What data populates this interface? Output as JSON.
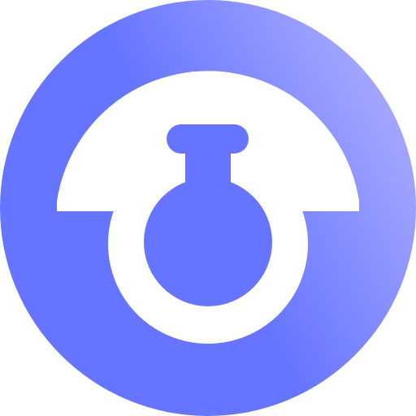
{
  "icon": {
    "name": "flask-logo-icon",
    "colors": {
      "gradient_start": "#6675FF",
      "gradient_end": "#A7A9FF",
      "flask_fill": "#6675FF",
      "foreground": "#FFFFFF"
    }
  }
}
